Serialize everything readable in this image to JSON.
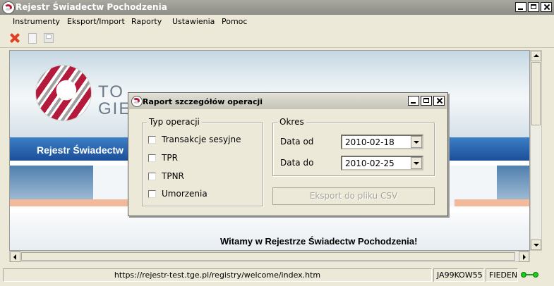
{
  "window": {
    "title": "Rejestr Świadectw Pochodzenia"
  },
  "menu": [
    "Instrumenty",
    "Eksport/Import",
    "Raporty",
    "Ustawienia",
    "Pomoc"
  ],
  "toolbar": {
    "icons": [
      "close-icon",
      "document-icon",
      "save-icon"
    ]
  },
  "page": {
    "brand_text_line1": "TO",
    "brand_text_line2": "GIE",
    "band_title": "Rejestr Świadectw",
    "welcome": "Witamy w Rejestrze Świadectw Pochodzenia!"
  },
  "dialog": {
    "title": "Raport szczegółów operacji",
    "typ_label": "Typ operacji",
    "options": [
      "Transakcje sesyjne",
      "TPR",
      "TPNR",
      "Umorzenia"
    ],
    "okres_label": "Okres",
    "date_from_label": "Data od",
    "date_from": "2010-02-18",
    "date_to_label": "Data do",
    "date_to": "2010-02-25",
    "export_button": "Eksport do pliku CSV"
  },
  "status": {
    "url": "https://rejestr-test.tge.pl/registry/welcome/index.htm",
    "user": "JA99KOW55",
    "name": "FIEDEN"
  },
  "colors": {
    "accent": "#b41a3c",
    "band": "#2a61ad",
    "status_ok": "#1ecc1e"
  }
}
